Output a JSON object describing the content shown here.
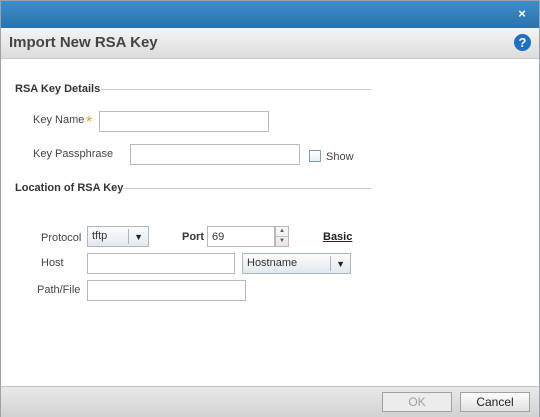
{
  "dialog": {
    "close_glyph": "×",
    "title": "Import New RSA Key",
    "help_glyph": "?"
  },
  "key_details": {
    "section_title": "RSA Key Details",
    "key_name_label": "Key Name",
    "required_mark": "*",
    "key_name_value": "",
    "passphrase_label": "Key Passphrase",
    "passphrase_value": "",
    "show_label": "Show",
    "show_checked": false
  },
  "location": {
    "section_title": "Location of RSA Key",
    "protocol_label": "Protocol",
    "protocol_value": "tftp",
    "port_label": "Port",
    "port_value": "69",
    "basic_link": "Basic",
    "host_label": "Host",
    "host_value": "",
    "host_type_value": "Hostname",
    "path_label": "Path/File",
    "path_value": ""
  },
  "footer": {
    "ok_label": "OK",
    "cancel_label": "Cancel"
  },
  "icons": {
    "close": "close-icon",
    "help": "help-icon",
    "dropdown": "chevron-down-icon",
    "spin_up": "triangle-up-icon",
    "spin_down": "triangle-down-icon"
  },
  "colors": {
    "titlebar": "#2f7dbb",
    "help_icon": "#1e6fc6",
    "required_mark": "#f39a2c"
  }
}
